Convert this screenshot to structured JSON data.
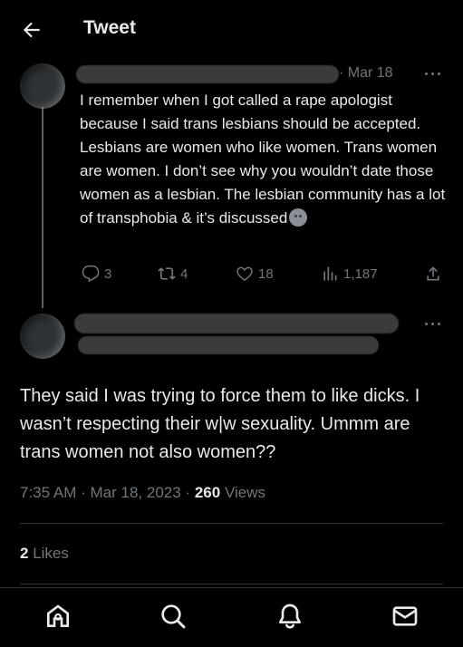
{
  "header": {
    "title": "Tweet"
  },
  "parent_tweet": {
    "date": "Mar 18",
    "separator": "·",
    "text": "I remember when I got called a rape apologist because I said trans lesbians should be accepted. Lesbians are women who like women. Trans women are women. I don’t see why you wouldn’t date those women as a lesbian. The lesbian community has a lot of transphobia & it’s discussed",
    "emoji": "slightly-frowning-face",
    "replies": "3",
    "retweets": "4",
    "likes": "18",
    "views": "1,187"
  },
  "main_tweet": {
    "text": "They said I was trying to force them to like dicks. I wasn’t respecting their w|w sexuality. Ummm are trans women not also women??",
    "time": "7:35 AM",
    "date": "Mar 18, 2023",
    "dot": "·",
    "views_count": "260",
    "views_label": "Views",
    "likes_count": "2",
    "likes_label": "Likes"
  },
  "bottom_nav": {
    "icons": [
      "home-icon",
      "search-icon",
      "notifications-icon",
      "messages-icon"
    ]
  },
  "colors": {
    "background": "#000000",
    "text_primary": "#e7e9ea",
    "text_secondary": "#71767b",
    "divider": "#2f3336"
  }
}
